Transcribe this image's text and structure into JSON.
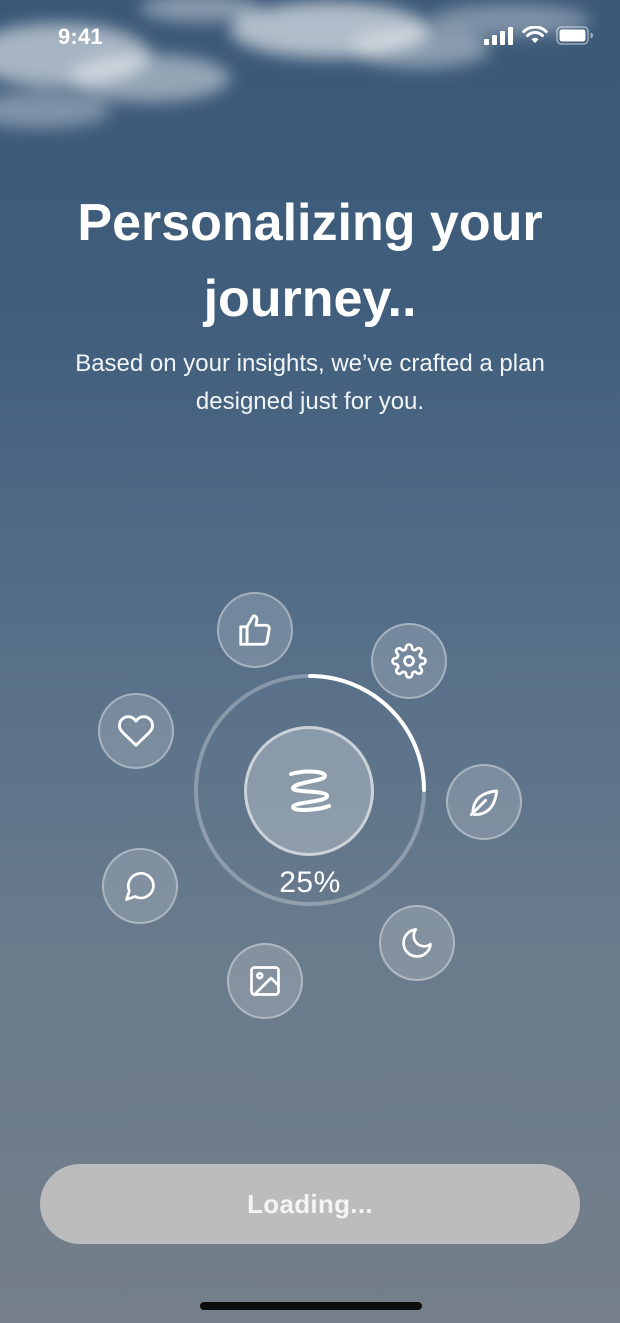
{
  "status_bar": {
    "time": "9:41",
    "icons": [
      "cellular-signal-icon",
      "wifi-icon",
      "battery-icon"
    ]
  },
  "headline": "Personalizing your journey..",
  "subtitle": "Based on your insights, we’ve crafted a plan designed just for you.",
  "progress": {
    "percent_label": "25%",
    "value": 0.25
  },
  "orbit_icons": [
    "thumbs-up-icon",
    "gear-icon",
    "heart-icon",
    "leaf-icon",
    "chat-bubble-icon",
    "moon-icon",
    "image-icon"
  ],
  "center_icon": "swirl-logo-icon",
  "button": {
    "label": "Loading..."
  },
  "colors": {
    "background_top": "#3a5877",
    "background_bottom": "#747f8a",
    "button_fill": "#bcbcbc",
    "progress_arc": "#ffffff"
  }
}
